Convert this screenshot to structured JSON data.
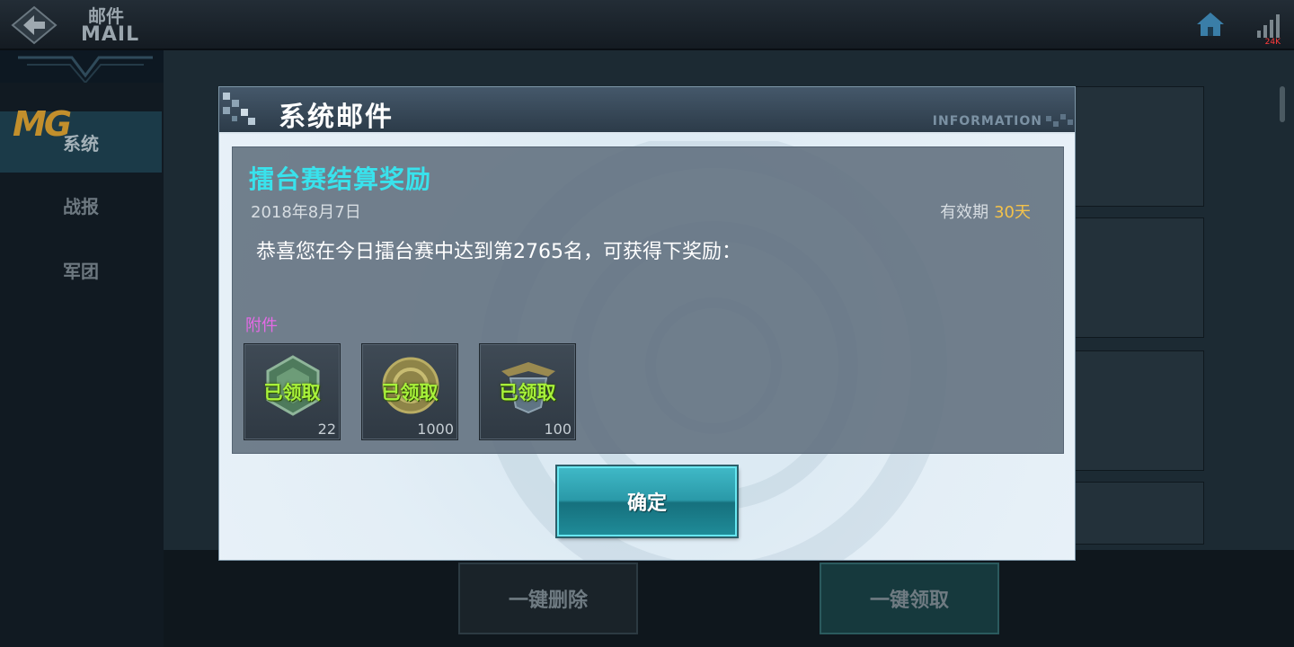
{
  "topbar": {
    "back_icon": "back-arrow-icon",
    "title_cn": "邮件",
    "title_en": "MAIL",
    "home_icon": "home-icon",
    "signal_icon": "signal-icon",
    "signal_label": "24K"
  },
  "sidebar": {
    "logo": "MG",
    "items": [
      {
        "label": "系统",
        "active": true
      },
      {
        "label": "战报",
        "active": false
      },
      {
        "label": "军团",
        "active": false
      }
    ]
  },
  "bottom": {
    "delete_all_label": "一键删除",
    "claim_all_label": "一键领取"
  },
  "modal": {
    "title": "系统邮件",
    "info_label": "INFORMATION",
    "subject": "擂台赛结算奖励",
    "date": "2018年8月7日",
    "validity_label": "有效期",
    "validity_days": "30天",
    "body": "恭喜您在今日擂台赛中达到第2765名，可获得下奖励：",
    "attachments_label": "附件",
    "attachments": [
      {
        "icon": "hexagon-medal-icon",
        "status": "已领取",
        "quantity": "22"
      },
      {
        "icon": "gold-coin-icon",
        "status": "已领取",
        "quantity": "1000"
      },
      {
        "icon": "winged-emblem-icon",
        "status": "已领取",
        "quantity": "100"
      }
    ],
    "confirm_label": "确定"
  },
  "colors": {
    "subject": "#39e2ec",
    "claimed": "#a8f23a",
    "attachments_label": "#e46ae6",
    "validity_days": "#f4c24a",
    "confirm_button": "#2a99a8"
  }
}
